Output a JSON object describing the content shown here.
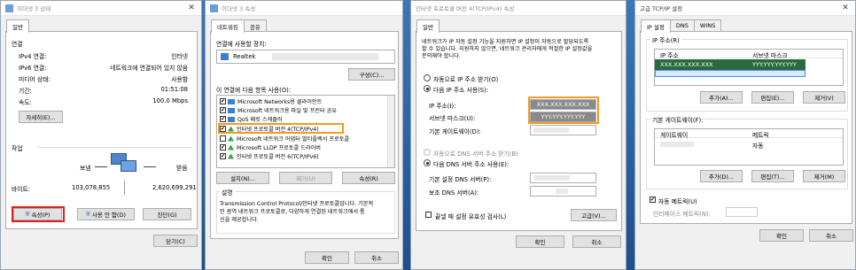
{
  "win1": {
    "title": "이더넷 3 상태",
    "tab_general": "일반",
    "section_connection": "연결",
    "rows": [
      {
        "label": "IPv4 연결:",
        "value": "인터넷"
      },
      {
        "label": "IPv6 연결:",
        "value": "네트워크에 연결되어 있지 않음"
      },
      {
        "label": "미디어 상태:",
        "value": "사용함"
      },
      {
        "label": "기간:",
        "value": "01:51:08"
      },
      {
        "label": "속도:",
        "value": "100.0 Mbps"
      }
    ],
    "details_btn": "자세히(E)...",
    "section_activity": "작업",
    "sent_label": "보냄",
    "recv_label": "받음",
    "bytes_label": "바이트:",
    "bytes_sent": "103,078,855",
    "bytes_recv": "2,620,699,291",
    "props_btn": "속성(P)",
    "disable_btn": "사용 안 함(D)",
    "diagnose_btn": "진단(G)",
    "close_btn": "닫기(C)"
  },
  "win2": {
    "title": "이더넷 3 속성",
    "tab_network": "네트워킹",
    "tab_share": "공유",
    "connect_using": "연결에 사용할 장치:",
    "adapter": "Realtek",
    "configure_btn": "구성(C)...",
    "items_label": "이 연결에 다음 항목 사용(O):",
    "items": [
      {
        "label": "Microsoft Networks용 클라이언트",
        "checked": true
      },
      {
        "label": "Microsoft 네트워크용 파일 및 프린터 공유",
        "checked": true
      },
      {
        "label": "QoS 패킷 스케줄러",
        "checked": true
      },
      {
        "label": "인터넷 프로토콜 버전 4(TCP/IPv4)",
        "checked": true
      },
      {
        "label": "Microsoft 네트워크 어댑터 멀티플렉서 프로토콜",
        "checked": false
      },
      {
        "label": "Microsoft LLDP 프로토콜 드라이버",
        "checked": true
      },
      {
        "label": "인터넷 프로토콜 버전 6(TCP/IPv6)",
        "checked": true
      }
    ],
    "install_btn": "설치(N)...",
    "remove_btn": "제거(U)",
    "props_btn": "속성(R)",
    "desc_title": "설명",
    "desc_text": [
      "Transmission Control Protocol/인터넷 프로토콜입니다. 기본적",
      "인 광역 네트워크 프로토콜로, 다양하게 연결된 네트워크에서 통",
      "신을 제공합니다."
    ],
    "ok_btn": "확인",
    "cancel_btn": "취소"
  },
  "win3": {
    "title": "인터넷 프로토콜 버전 4(TCP/IPv4) 속성",
    "tab_general": "일반",
    "intro": [
      "네트워크가 IP 자동 설정 기능을 지원하면 IP 설정이 자동으로 할당되도록",
      "할 수 있습니다. 지원하지 않으면, 네트워크 관리자에게 적절한 IP 설정값을",
      "문의해야 합니다."
    ],
    "auto_ip": "자동으로 IP 주소 받기(O)",
    "manual_ip": "다음 IP 주소 사용(S):",
    "ip_label": "IP 주소(I):",
    "ip_value": "XXX.XXX.XXX.XXX",
    "mask_label": "서브넷 마스크(U):",
    "mask_value": "YYY.YYY.YYY.YYY",
    "gateway_label": "기본 게이트웨이(D):",
    "auto_dns": "자동으로 DNS 서버 주소 받기(B)",
    "manual_dns": "다음 DNS 서버 주소 사용(E):",
    "dns1_label": "기본 설정 DNS 서버(P):",
    "dns2_label": "보조 DNS 서버(A):",
    "validate": "끝낼 때 설정 유효성 검사(L)",
    "advanced_btn": "고급(V)...",
    "ok_btn": "확인",
    "cancel_btn": "취소"
  },
  "win4": {
    "title": "고급 TCP/IP 설정",
    "tabs": [
      "IP 설정",
      "DNS",
      "WINS"
    ],
    "ip_section": "IP 주소(R)",
    "col_ip": "IP 주소",
    "col_mask": "서브넷 마스크",
    "ip_value": "XXX.XXX.XXX.XXX",
    "mask_value": "YYY.YYY.YYY.YYY",
    "add_btn": "추가(A)...",
    "edit_btn": "편집(E)...",
    "remove_btn": "제거(V)",
    "gw_section": "기본 게이트웨이(F):",
    "col_gw": "게이트웨이",
    "col_metric": "메트릭",
    "metric_value": "자동",
    "add2_btn": "추가(D)...",
    "edit2_btn": "편집(T)...",
    "remove2_btn": "제거(M)",
    "auto_metric": "자동 메트릭(U)",
    "iface_metric": "인터페이스 메트릭(N):",
    "ok_btn": "확인",
    "cancel_btn": "취소"
  }
}
